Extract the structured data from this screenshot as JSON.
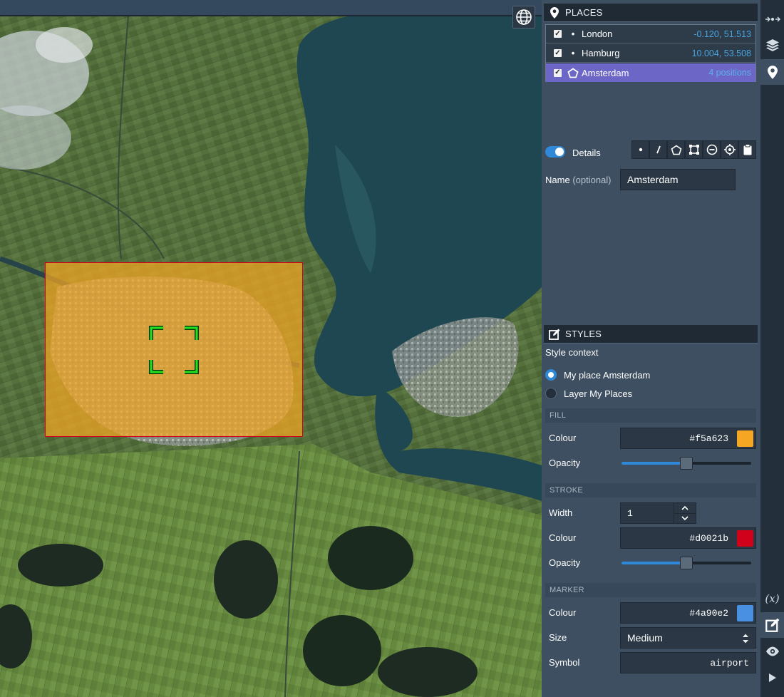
{
  "map": {
    "rect_fill": "#f5a623",
    "rect_stroke": "#d0021b",
    "marker_color": "#22e022"
  },
  "places": {
    "title": "PLACES",
    "items": [
      {
        "name": "London",
        "value": "-0.120, 51.513",
        "checked": true,
        "icon": "point-icon"
      },
      {
        "name": "Hamburg",
        "value": "10.004, 53.508",
        "checked": true,
        "icon": "point-icon"
      },
      {
        "name": "Amsterdam",
        "value": "4 positions",
        "checked": true,
        "icon": "polygon-icon",
        "selected": true
      }
    ]
  },
  "details": {
    "toggle_label": "Details",
    "toggle_on": true,
    "tools": [
      "point-tool-icon",
      "line-tool-icon",
      "polygon-tool-icon",
      "rectangle-tool-icon",
      "circle-minus-icon",
      "crosshair-icon",
      "clipboard-icon"
    ],
    "name_label": "Name",
    "name_optional": "(optional)",
    "name_value": "Amsterdam"
  },
  "styles": {
    "title": "STYLES",
    "context_label": "Style context",
    "context_options": [
      {
        "label": "My place Amsterdam",
        "selected": true
      },
      {
        "label": "Layer My Places",
        "selected": false
      }
    ],
    "fill": {
      "header": "FILL",
      "colour_label": "Colour",
      "colour_value": "#f5a623",
      "opacity_label": "Opacity",
      "opacity": 0.5
    },
    "stroke": {
      "header": "STROKE",
      "width_label": "Width",
      "width_value": "1",
      "colour_label": "Colour",
      "colour_value": "#d0021b",
      "opacity_label": "Opacity",
      "opacity": 0.5
    },
    "marker": {
      "header": "MARKER",
      "colour_label": "Colour",
      "colour_value": "#4a90e2",
      "size_label": "Size",
      "size_value": "Medium",
      "symbol_label": "Symbol",
      "symbol_value": "airport"
    }
  },
  "rail": {
    "top_items": [
      "collapse-arrows-icon",
      "layers-icon",
      "map-pin-icon"
    ],
    "bottom_items": [
      "variables-icon",
      "edit-style-icon",
      "eye-icon",
      "play-icon"
    ],
    "variables_text": "(x)"
  }
}
